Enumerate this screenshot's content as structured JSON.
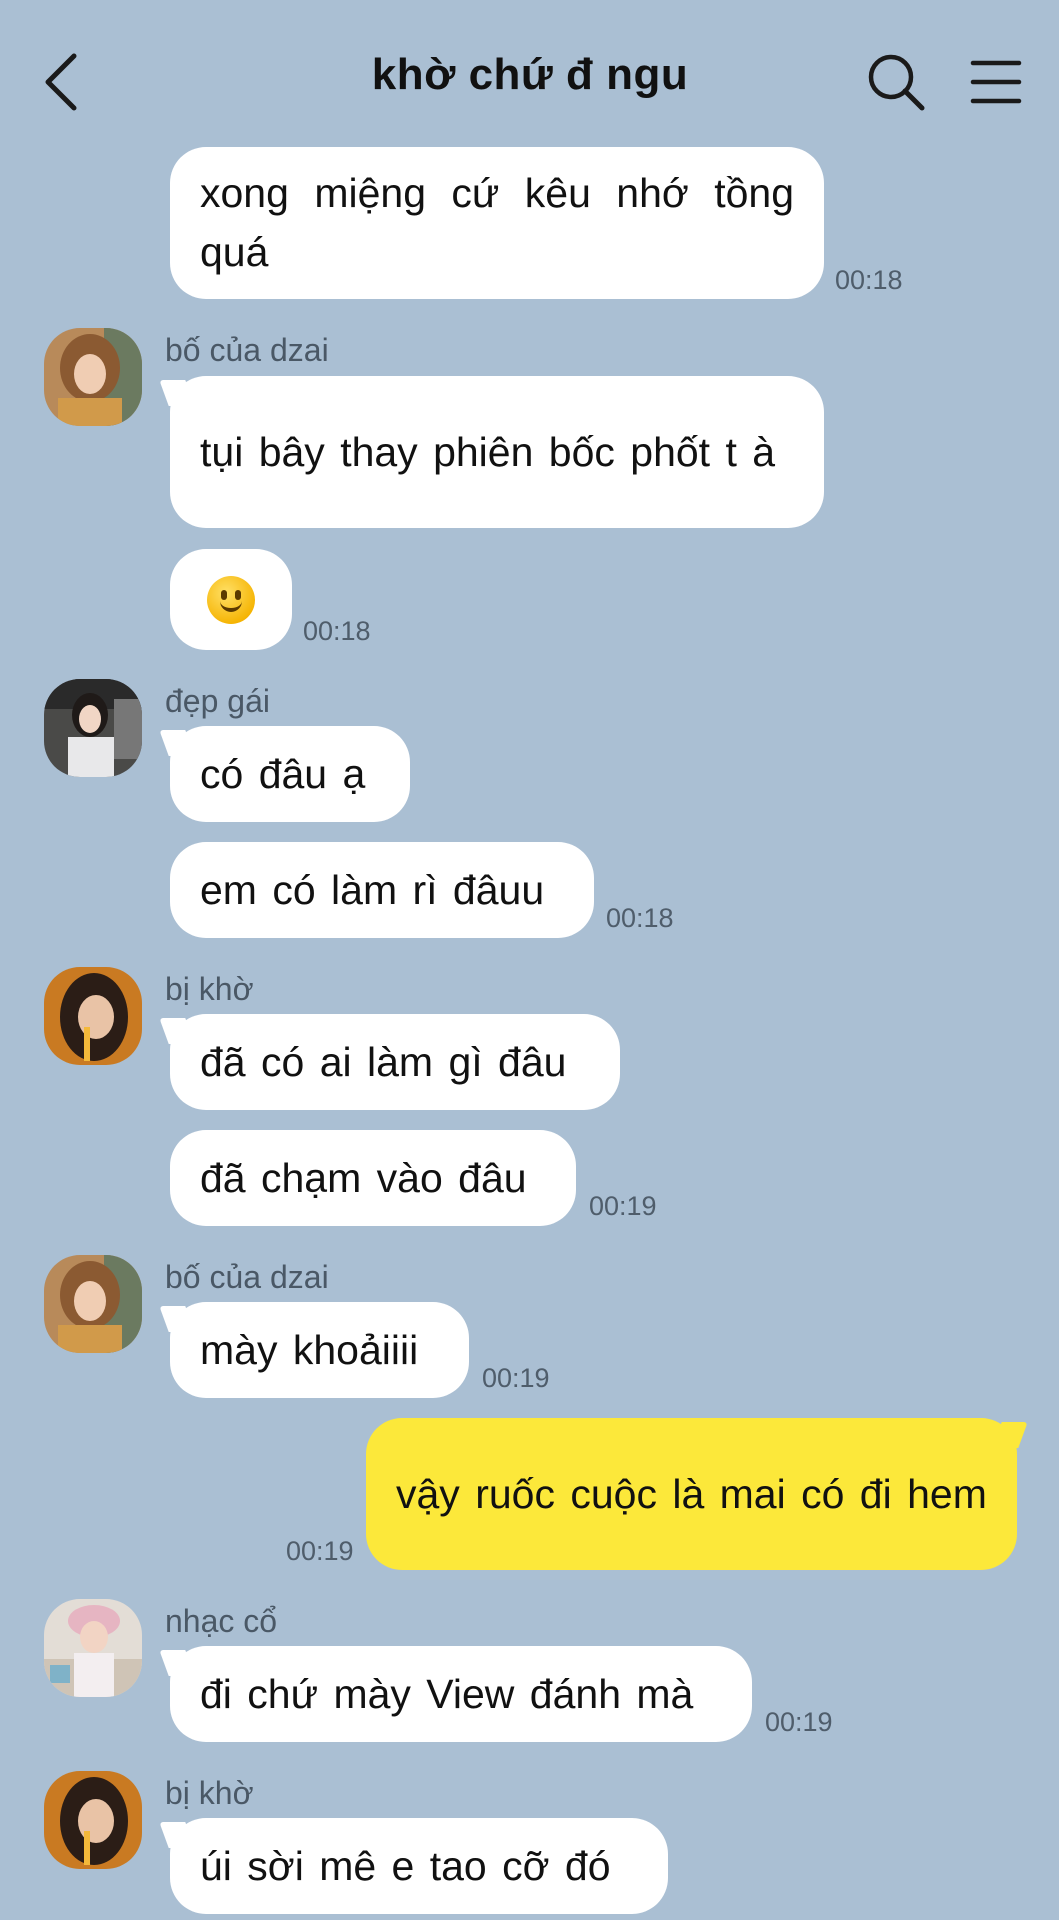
{
  "header": {
    "title": "khờ chứ đ ngu",
    "back_icon": "chevron-left-icon",
    "search_icon": "search-icon",
    "menu_icon": "hamburger-menu-icon"
  },
  "colors": {
    "background": "#aabfd3",
    "bubble_in": "#ffffff",
    "bubble_out": "#fce83a"
  },
  "messages": [
    {
      "text": "xong miệng cứ kêu nhớ tồng quá",
      "time": "00:18"
    },
    {
      "sender": "bố của dzai",
      "text": "tụi bây thay phiên bốc phốt t à"
    },
    {
      "emoji": "slightly-smiling-face",
      "time": "00:18"
    },
    {
      "sender": "đẹp gái",
      "text": "có đâu ạ"
    },
    {
      "text": "em có làm rì đâuu",
      "time": "00:18"
    },
    {
      "sender": "bị khờ",
      "text": "đã có ai làm gì đâu"
    },
    {
      "text": "đã chạm vào đâu",
      "time": "00:19"
    },
    {
      "sender": "bố của dzai",
      "text": "mày khoảiiii",
      "time": "00:19"
    },
    {
      "sender": "me",
      "text": "vậy ruốc cuộc là mai có đi hem",
      "time": "00:19"
    },
    {
      "sender": "nhạc cổ",
      "text": "đi chứ mày View đánh mà",
      "time": "00:19"
    },
    {
      "sender": "bị khờ",
      "text": "úi sời mê e tao cỡ đó"
    }
  ]
}
